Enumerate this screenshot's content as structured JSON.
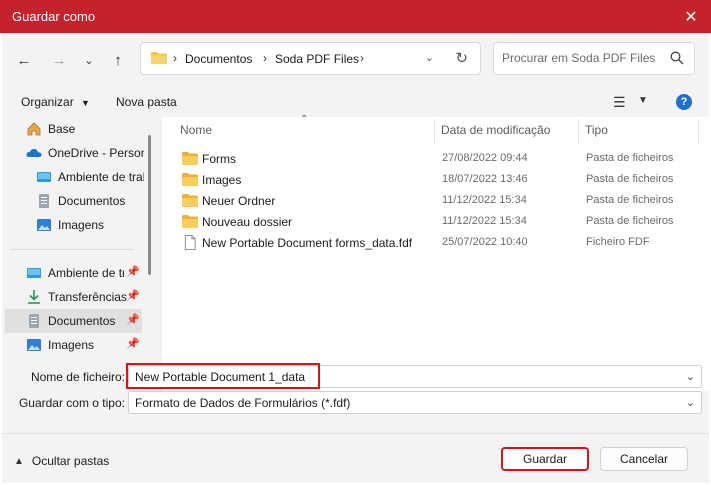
{
  "window": {
    "title": "Guardar como"
  },
  "nav": {
    "breadcrumbs": [
      "Documentos",
      "Soda PDF Files"
    ]
  },
  "search": {
    "placeholder": "Procurar em Soda PDF Files"
  },
  "toolbar": {
    "organize_label": "Organizar",
    "new_folder_label": "Nova pasta"
  },
  "sidebar": {
    "items": [
      {
        "label": "Base",
        "icon": "home-icon"
      },
      {
        "label": "OneDrive - Personal",
        "icon": "cloud-icon"
      },
      {
        "label": "Ambiente de trabalho",
        "icon": "desktop-icon"
      },
      {
        "label": "Documentos",
        "icon": "document-icon"
      },
      {
        "label": "Imagens",
        "icon": "image-icon"
      },
      {
        "label": "Ambiente de trabalho",
        "icon": "desktop-icon",
        "pinned": true
      },
      {
        "label": "Transferências",
        "icon": "download-icon",
        "pinned": true
      },
      {
        "label": "Documentos",
        "icon": "document-icon",
        "pinned": true,
        "selected": true
      },
      {
        "label": "Imagens",
        "icon": "image-icon",
        "pinned": true
      }
    ]
  },
  "files": {
    "columns": {
      "name": "Nome",
      "date": "Data de modificação",
      "type": "Tipo"
    },
    "rows": [
      {
        "name": "Forms",
        "date": "27/08/2022 09:44",
        "type": "Pasta de ficheiros",
        "kind": "folder"
      },
      {
        "name": "Images",
        "date": "18/07/2022 13:46",
        "type": "Pasta de ficheiros",
        "kind": "folder"
      },
      {
        "name": "Neuer Ordner",
        "date": "11/12/2022 15:34",
        "type": "Pasta de ficheiros",
        "kind": "folder"
      },
      {
        "name": "Nouveau dossier",
        "date": "11/12/2022 15:34",
        "type": "Pasta de ficheiros",
        "kind": "folder"
      },
      {
        "name": "New Portable Document forms_data.fdf",
        "date": "25/07/2022 10:40",
        "type": "Ficheiro FDF",
        "kind": "file"
      }
    ]
  },
  "form": {
    "filename_label": "Nome de ficheiro:",
    "filename_value": "New Portable Document 1_data",
    "filetype_label": "Guardar com o tipo:",
    "filetype_value": "Formato de Dados de Formulários (*.fdf)"
  },
  "footer": {
    "hide_folders_label": "Ocultar pastas",
    "save_label": "Guardar",
    "cancel_label": "Cancelar"
  },
  "colors": {
    "titlebar": "#c4232d",
    "highlight": "#d8131b",
    "folder": "#f4c542"
  }
}
